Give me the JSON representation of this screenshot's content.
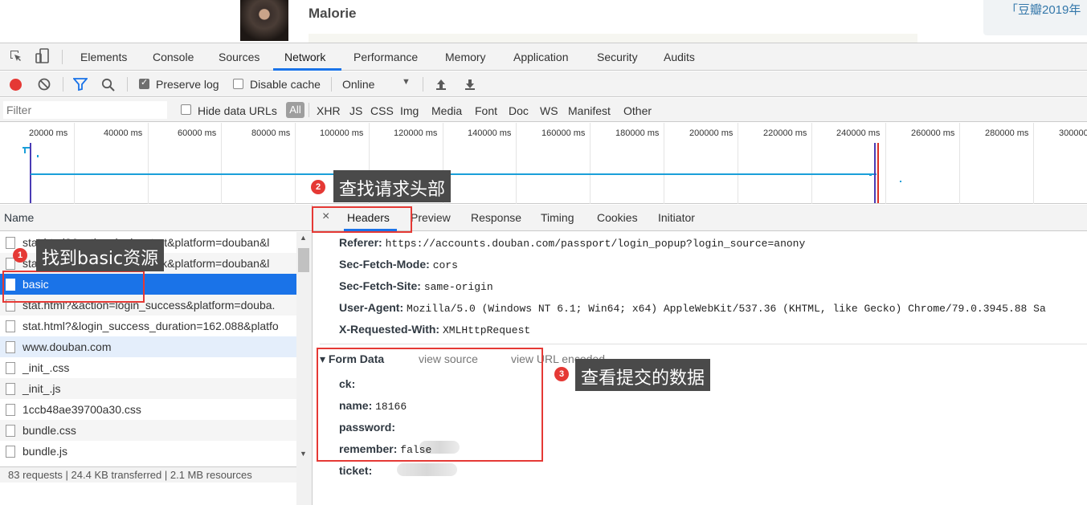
{
  "page": {
    "profile_name": "Malorie",
    "promo_text": "「豆瓣2019年"
  },
  "devtools": {
    "main_tabs": [
      "Elements",
      "Console",
      "Sources",
      "Network",
      "Performance",
      "Memory",
      "Application",
      "Security",
      "Audits"
    ],
    "active_tab": "Network",
    "toolbar": {
      "preserve_log": "Preserve log",
      "preserve_log_checked": true,
      "disable_cache": "Disable cache",
      "disable_cache_checked": false,
      "throttle": "Online"
    },
    "filterbar": {
      "placeholder": "Filter",
      "hide_data_urls": "Hide data URLs",
      "all": "All",
      "types": [
        "XHR",
        "JS",
        "CSS",
        "Img",
        "Media",
        "Font",
        "Doc",
        "WS",
        "Manifest",
        "Other"
      ]
    },
    "timeline": {
      "labels": [
        "20000 ms",
        "40000 ms",
        "60000 ms",
        "80000 ms",
        "100000 ms",
        "120000 ms",
        "140000 ms",
        "160000 ms",
        "180000 ms",
        "200000 ms",
        "220000 ms",
        "240000 ms",
        "260000 ms",
        "280000 ms",
        "300000"
      ]
    },
    "request_list": {
      "header": "Name",
      "rows": [
        "stat.html?&action=login_start&platform=douban&l",
        "stat.html?&action=login_click&platform=douban&l",
        "basic",
        "stat.html?&action=login_success&platform=douba.",
        "stat.html?&login_success_duration=162.088&platfo",
        "www.douban.com",
        "_init_.css",
        "_init_.js",
        "1ccb48ae39700a30.css",
        "bundle.css",
        "bundle.js"
      ],
      "selected": "basic",
      "status": "83 requests  |  24.4 KB transferred  |  2.1 MB resources"
    },
    "detail_tabs": {
      "close": "×",
      "tabs": [
        "Headers",
        "Preview",
        "Response",
        "Timing",
        "Cookies",
        "Initiator"
      ],
      "active": "Headers"
    },
    "headers": [
      {
        "key": "Referer:",
        "value": "https://accounts.douban.com/passport/login_popup?login_source=anony"
      },
      {
        "key": "Sec-Fetch-Mode:",
        "value": "cors"
      },
      {
        "key": "Sec-Fetch-Site:",
        "value": "same-origin"
      },
      {
        "key": "User-Agent:",
        "value": "Mozilla/5.0 (Windows NT 6.1; Win64; x64) AppleWebKit/537.36 (KHTML, like Gecko) Chrome/79.0.3945.88 Sa"
      },
      {
        "key": "X-Requested-With:",
        "value": "XMLHttpRequest"
      }
    ],
    "form_data": {
      "title": "▾ Form Data",
      "view_source": "view source",
      "view_url_encoded": "view URL encoded",
      "fields": [
        {
          "key": "ck:",
          "value": ""
        },
        {
          "key": "name:",
          "value": "18166"
        },
        {
          "key": "password:",
          "value": ""
        },
        {
          "key": "remember:",
          "value": "false"
        },
        {
          "key": "ticket:",
          "value": ""
        }
      ]
    }
  },
  "annotations": [
    {
      "num": "1",
      "label": "找到basic资源"
    },
    {
      "num": "2",
      "label": "查找请求头部"
    },
    {
      "num": "3",
      "label": "查看提交的数据"
    }
  ],
  "colors": {
    "accent": "#1a73e8",
    "annotation_red": "#e53935",
    "timeline_bar": "#1a9fd9"
  }
}
